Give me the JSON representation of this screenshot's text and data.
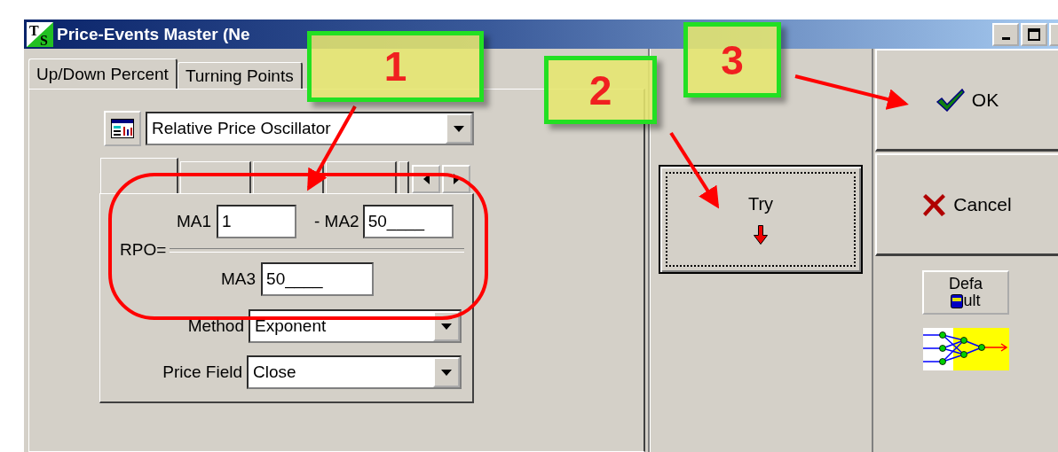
{
  "window": {
    "logo_top": "T",
    "logo_bottom": "S",
    "title": "Price-Events Master (Ne"
  },
  "tabs": [
    {
      "label": "Up/Down Percent",
      "selected": true
    },
    {
      "label": "Turning Points",
      "selected": false
    }
  ],
  "indicator": {
    "value": "Relative Price Oscillator"
  },
  "subtabs": [
    {
      "selected": true
    },
    {
      "selected": false
    },
    {
      "selected": false
    },
    {
      "selected": false
    },
    {
      "selected": false
    }
  ],
  "formula": {
    "ma1_label": "MA1",
    "ma1_value": "1",
    "ma2_label": "- MA2",
    "ma2_value": "50____",
    "rpo_label": "RPO=",
    "ma3_label": "MA3",
    "ma3_value": "50____"
  },
  "method": {
    "label": "Method",
    "value": "Exponent"
  },
  "price_field": {
    "label": "Price Field",
    "value": "Close"
  },
  "try_button": {
    "label": "Try"
  },
  "ok_button": {
    "label": "OK"
  },
  "cancel_button": {
    "label": "Cancel"
  },
  "default_button": {
    "line_1": "Defa",
    "line_2": "ult"
  },
  "callouts": [
    {
      "label": "1"
    },
    {
      "label": "2"
    },
    {
      "label": "3"
    }
  ]
}
